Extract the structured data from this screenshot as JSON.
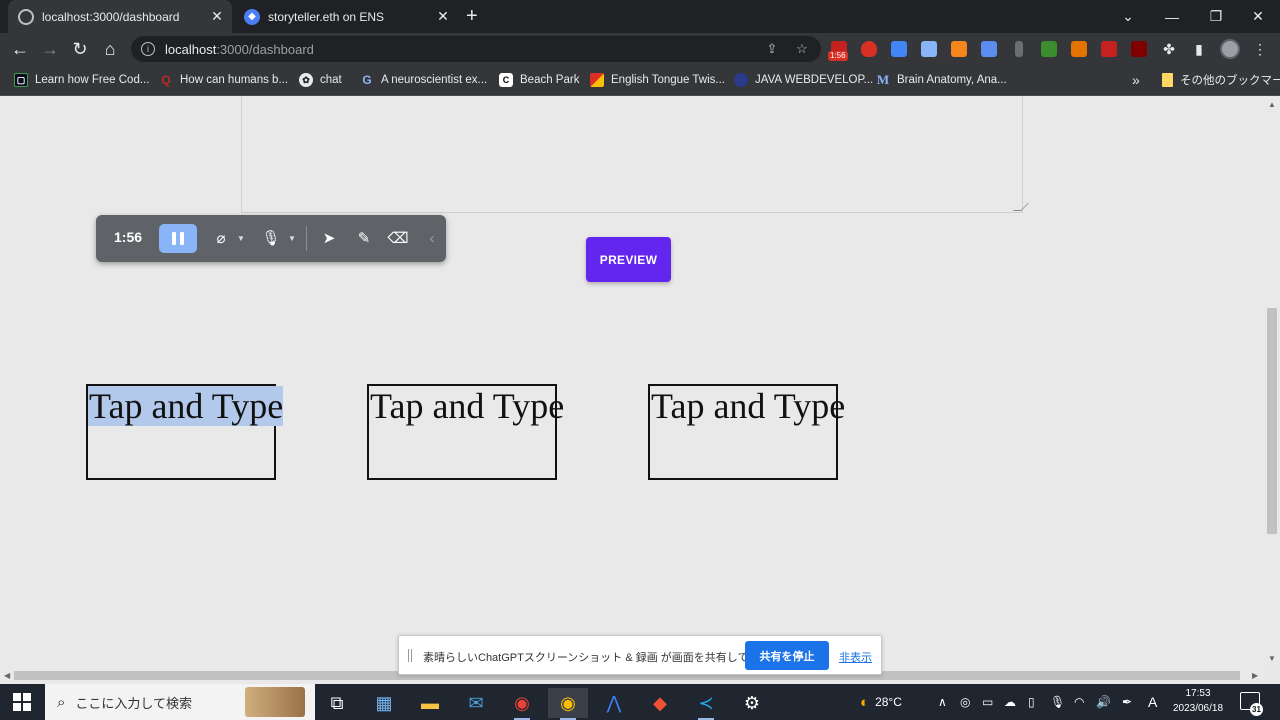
{
  "browser": {
    "tabs": [
      {
        "title": "localhost:3000/dashboard",
        "active": true
      },
      {
        "title": "storyteller.eth on ENS",
        "active": false
      }
    ],
    "url_host": "localhost",
    "url_path": ":3000/dashboard",
    "extension_badge": "1:56",
    "bookmarks": [
      {
        "label": "Learn how Free Cod...",
        "icon": "freecodecamp-icon",
        "color": "#0a0a23"
      },
      {
        "label": "How can humans b...",
        "icon": "quora-icon",
        "color": "#b92b27"
      },
      {
        "label": "chat",
        "icon": "openai-icon",
        "color": "#202124"
      },
      {
        "label": "A neuroscientist ex...",
        "icon": "google-icon",
        "color": "#202124"
      },
      {
        "label": "Beach Park",
        "icon": "c-icon",
        "color": "#202124"
      },
      {
        "label": "English Tongue Twis...",
        "icon": "flag-icon",
        "color": "#d93025"
      },
      {
        "label": "JAVA WEBDEVELOP...",
        "icon": "java-icon",
        "color": "#2b3a8c"
      },
      {
        "label": "Brain Anatomy, Ana...",
        "icon": "m-icon",
        "color": "#1a73e8"
      }
    ],
    "bookmarks_overflow": "»",
    "other_bookmarks": "その他のブックマーク"
  },
  "recorder": {
    "time": "1:56"
  },
  "page": {
    "preview_label": "PREVIEW",
    "boxes": [
      {
        "text": "Tap and Type",
        "selected": true
      },
      {
        "text": "Tap and Type",
        "selected": false
      },
      {
        "text": "Tap and Type",
        "selected": false
      }
    ]
  },
  "share_bar": {
    "message": "素晴らしいChatGPTスクリーンショット & 録画 が画面を共有しています。",
    "stop_label": "共有を停止",
    "hide_label": "非表示"
  },
  "taskbar": {
    "search_placeholder": "ここに入力して検索",
    "weather": "28°C",
    "ime": "A",
    "time": "17:53",
    "date": "2023/06/18",
    "notifications": "31"
  },
  "colors": {
    "accent": "#6226ef",
    "selection": "#b3c9ec",
    "share_button": "#1a73e8"
  }
}
